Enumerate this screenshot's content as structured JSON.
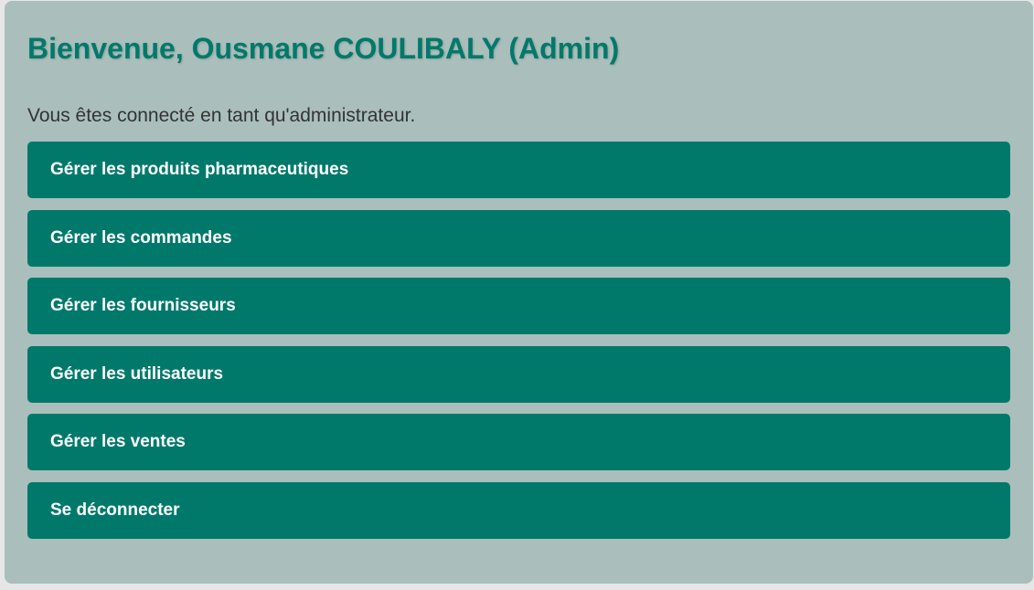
{
  "page": {
    "title": "Bienvenue, Ousmane COULIBALY (Admin)",
    "subtitle": "Vous êtes connecté en tant qu'administrateur."
  },
  "menu": {
    "items": [
      {
        "label": "Gérer les produits pharmaceutiques"
      },
      {
        "label": "Gérer les commandes"
      },
      {
        "label": "Gérer les fournisseurs"
      },
      {
        "label": "Gérer les utilisateurs"
      },
      {
        "label": "Gérer les ventes"
      },
      {
        "label": "Se déconnecter"
      }
    ]
  },
  "colors": {
    "accent": "#00796b",
    "card_background": "#aabfbb",
    "text": "#333333",
    "button_text": "#ffffff"
  }
}
